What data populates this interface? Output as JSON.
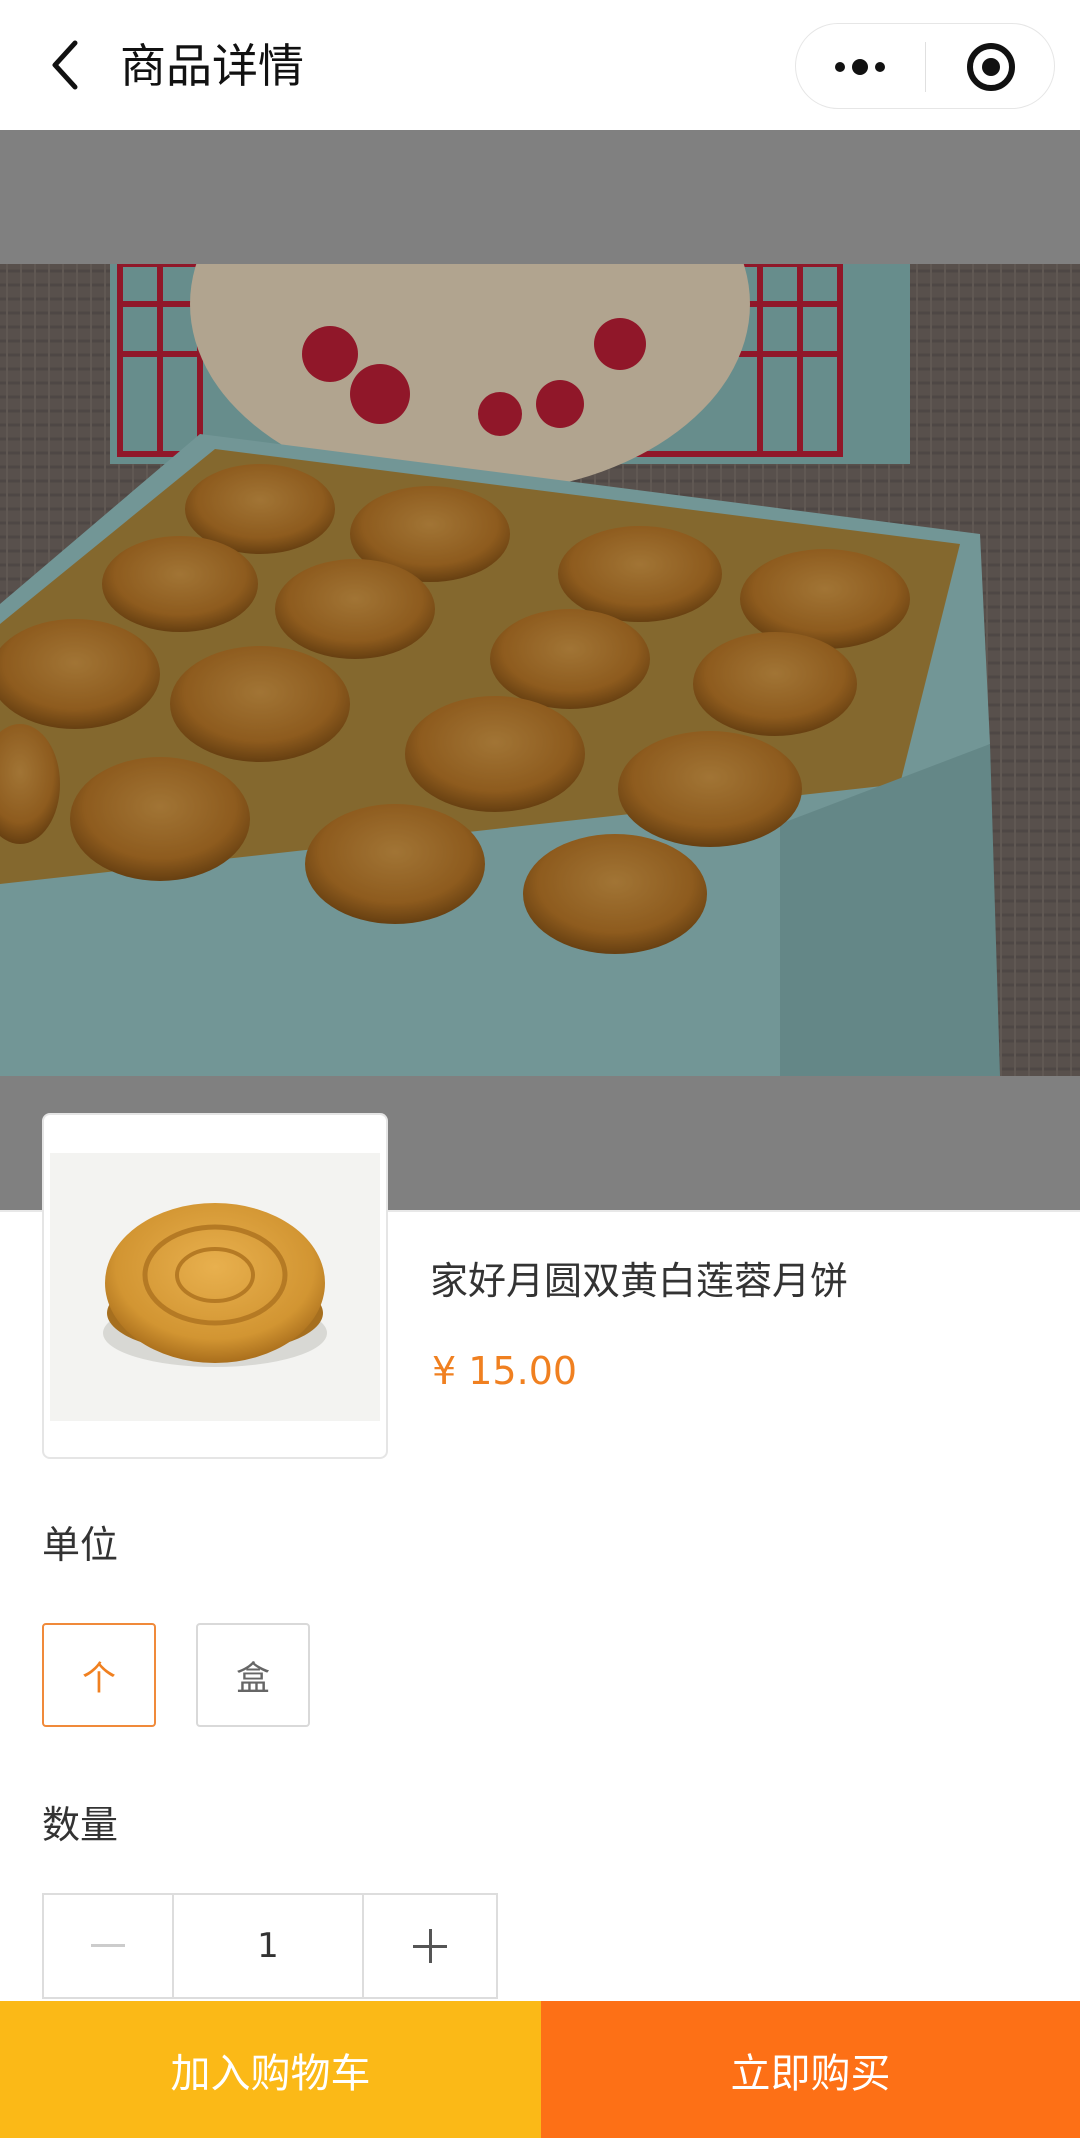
{
  "navbar": {
    "title": "商品详情",
    "back_icon": "chevron-left-icon",
    "more_icon": "more-dots-icon",
    "target_icon": "target-circle-icon"
  },
  "hero": {
    "image": "mooncake-gift-box-photo"
  },
  "product": {
    "thumbnail": "single-mooncake-photo",
    "name": "家好月圆双黄白莲蓉月饼",
    "price": "¥ 15.00"
  },
  "unit": {
    "label": "单位",
    "options": [
      "个",
      "盒"
    ],
    "selected": "个"
  },
  "quantity": {
    "label": "数量",
    "minus": "—",
    "value": "1",
    "plus": "+"
  },
  "actions": {
    "add_to_cart": "加入购物车",
    "buy_now": "立即购买"
  },
  "colors": {
    "accent": "#f08020",
    "cart_button": "#fbb917",
    "buy_button": "#fd7016",
    "overlay": "#808080"
  }
}
